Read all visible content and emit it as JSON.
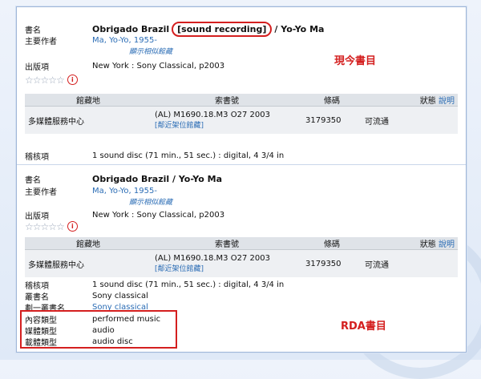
{
  "labels": {
    "title": "書名",
    "author": "主要作者",
    "publish": "出版項",
    "physical": "稽核項",
    "series": "叢書名",
    "series_alt": "劃一叢書名",
    "content_type": "內容類型",
    "media_type": "媒體類型",
    "carrier_type": "載體類型"
  },
  "holding_headers": {
    "location": "館藏地",
    "callno": "索書號",
    "barcode": "條碼",
    "status": "狀態",
    "status_link": "說明"
  },
  "record1": {
    "title_main": "Obrigado Brazil",
    "title_gmd": "[sound recording]",
    "title_rest": "/ Yo-Yo Ma",
    "author": "Ma, Yo-Yo, 1955-",
    "similar": "顯示相似館藏",
    "publish": "New York : Sony Classical, p2003",
    "holding": {
      "location": "多媒體服務中心",
      "callno": "(AL) M1690.18.M3 O27 2003",
      "nearby": "[鄰近架位館藏]",
      "barcode": "3179350",
      "status": "可流通"
    },
    "physical": "1 sound disc (71 min., 51 sec.) : digital, 4 3/4 in",
    "tag": "現今書目"
  },
  "record2": {
    "title": "Obrigado Brazil / Yo-Yo Ma",
    "author": "Ma, Yo-Yo, 1955-",
    "similar": "顯示相似館藏",
    "publish": "New York : Sony Classical, p2003",
    "holding": {
      "location": "多媒體服務中心",
      "callno": "(AL) M1690.18.M3 O27 2003",
      "nearby": "[鄰近架位館藏]",
      "barcode": "3179350",
      "status": "可流通"
    },
    "physical": "1 sound disc (71 min., 51 sec.) : digital, 4 3/4 in",
    "series": "Sony classical",
    "series_alt": "Sony classical",
    "content_type": "performed music",
    "media_type": "audio",
    "carrier_type": "audio disc",
    "tag": "RDA書目"
  },
  "rating": {
    "stars_filled": 0,
    "stars_total": 5,
    "info_icon": "info-icon"
  },
  "colors": {
    "accent_red": "#d41f1f",
    "link_blue": "#2a6cb5"
  }
}
